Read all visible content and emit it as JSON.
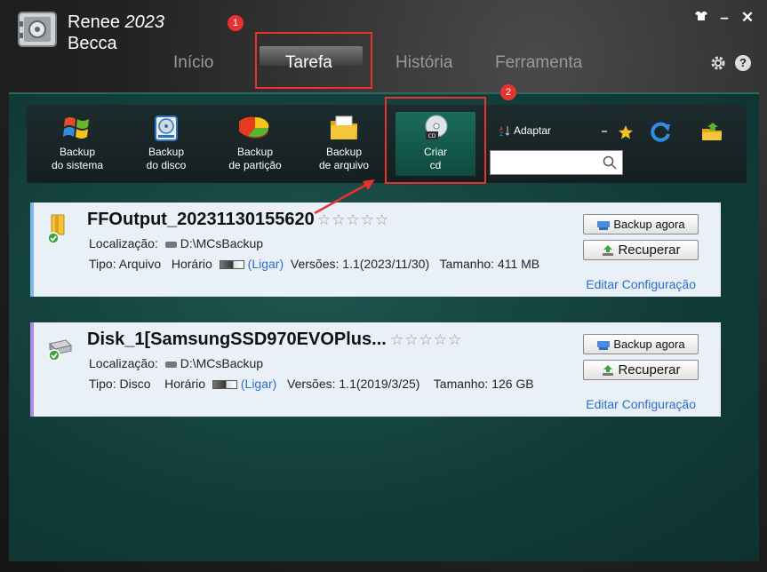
{
  "app": {
    "title_prefix": "Renee ",
    "title_year": "2023",
    "title_line2": "Becca",
    "minimize": "–",
    "close": "✕",
    "help": "?"
  },
  "nav": {
    "tabs": [
      "Início",
      "Tarefa",
      "História",
      "Ferramenta"
    ],
    "active": "Tarefa"
  },
  "annotations": {
    "badge1": "1",
    "badge2": "2",
    "color": "#e8322f"
  },
  "toolbar": {
    "items": [
      {
        "line1": "Backup",
        "line2": "do sistema",
        "icon": "windows-logo-icon"
      },
      {
        "line1": "Backup",
        "line2": "do disco",
        "icon": "disk-icon"
      },
      {
        "line1": "Backup",
        "line2": "de partição",
        "icon": "pie-chart-icon"
      },
      {
        "line1": "Backup",
        "line2": "de arquivo",
        "icon": "folder-icon"
      },
      {
        "line1": "Criar",
        "line2": "cd",
        "icon": "cd-icon"
      }
    ],
    "adapt_label": "Adaptar",
    "search_value": ""
  },
  "tasks": [
    {
      "name": "FFOutput_20231130155620",
      "location_label": "Localização:",
      "location": "D:\\MCsBackup",
      "type_label": "Tipo:",
      "type": "Arquivo",
      "schedule_label": "Horário",
      "schedule_state": "(Ligar)",
      "versions_label": "Versões:",
      "versions": "1.1(2023/11/30)",
      "size_label": "Tamanho:",
      "size": "411 MB",
      "rating": 0,
      "stars": "☆☆☆☆☆",
      "backup_btn": "Backup agora",
      "restore_btn": "Recuperar",
      "edit_link": "Editar Configuração"
    },
    {
      "name": "Disk_1[SamsungSSD970EVOPlus...",
      "location_label": "Localização:",
      "location": "D:\\MCsBackup",
      "type_label": "Tipo:",
      "type": "Disco",
      "schedule_label": "Horário",
      "schedule_state": "(Ligar)",
      "versions_label": "Versões:",
      "versions": "1.1(2019/3/25)",
      "size_label": "Tamanho:",
      "size": "126 GB",
      "rating": 0,
      "stars": "☆☆☆☆☆",
      "backup_btn": "Backup agora",
      "restore_btn": "Recuperar",
      "edit_link": "Editar Configuração"
    }
  ]
}
